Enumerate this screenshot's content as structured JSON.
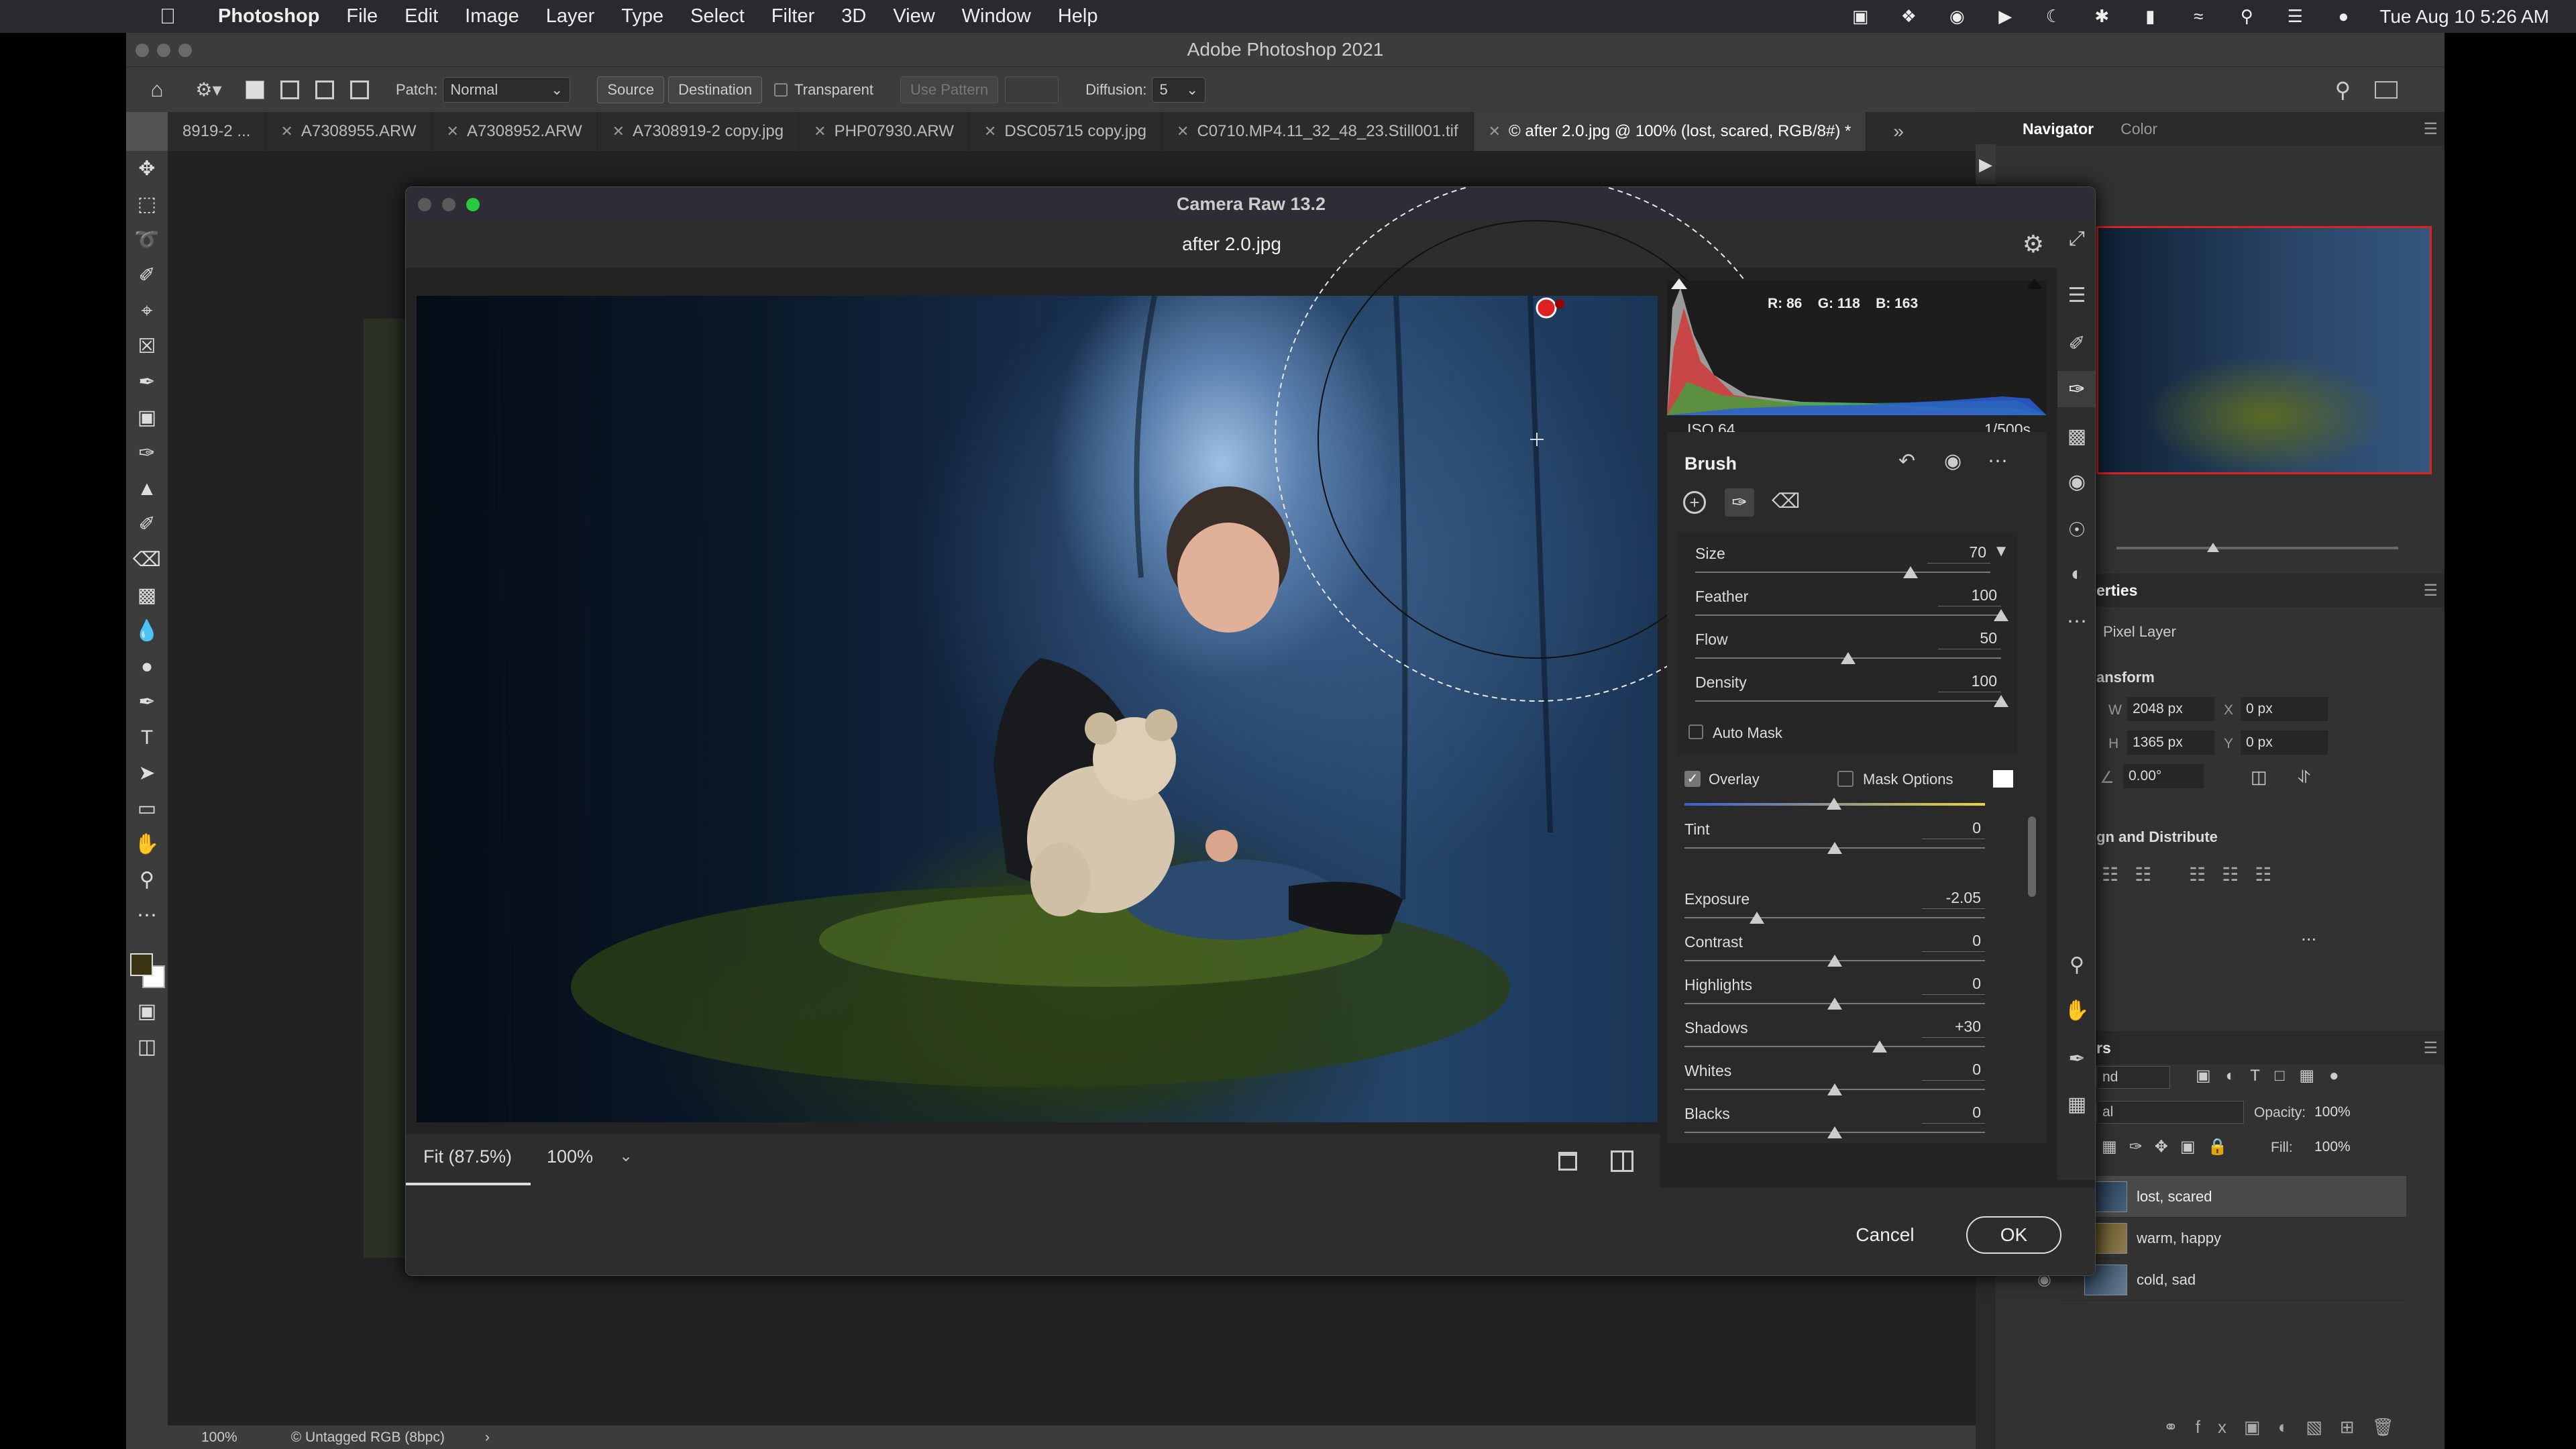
{
  "menubar": {
    "app_name": "Photoshop",
    "items": [
      "File",
      "Edit",
      "Image",
      "Layer",
      "Type",
      "Select",
      "Filter",
      "3D",
      "View",
      "Window",
      "Help"
    ],
    "datetime": "Tue Aug 10  5:26 AM"
  },
  "window": {
    "title": "Adobe Photoshop 2021"
  },
  "options_bar": {
    "patch_label": "Patch:",
    "patch_value": "Normal",
    "source_label": "Source",
    "destination_label": "Destination",
    "transparent_label": "Transparent",
    "use_pattern_label": "Use Pattern",
    "diffusion_label": "Diffusion:",
    "diffusion_value": "5"
  },
  "tabs": [
    {
      "label": "8919-2 ..."
    },
    {
      "label": "A7308955.ARW"
    },
    {
      "label": "A7308952.ARW"
    },
    {
      "label": "A7308919-2 copy.jpg"
    },
    {
      "label": "PHP07930.ARW"
    },
    {
      "label": "DSC05715 copy.jpg"
    },
    {
      "label": "C0710.MP4.11_32_48_23.Still001.tif"
    },
    {
      "label": "© after 2.0.jpg @ 100% (lost, scared, RGB/8#) *"
    }
  ],
  "status_bar": {
    "zoom": "100%",
    "profile": "Untagged RGB (8bpc)"
  },
  "right_panel": {
    "navigator_tab": "Navigator",
    "color_tab": "Color",
    "properties_tab": "erties",
    "pixel_layer": "Pixel Layer",
    "transform_heading": "ansform",
    "w_label": "W",
    "w_value": "2048 px",
    "h_label": "H",
    "h_value": "1365 px",
    "x_label": "X",
    "x_value": "0 px",
    "y_label": "Y",
    "y_value": "0 px",
    "angle_value": "0.00°",
    "align_heading": "gn and Distribute",
    "more": "...",
    "layers_tab": "rs",
    "kind_value": "nd",
    "blend_value": "al",
    "opacity_label": "Opacity:",
    "opacity_value": "100%",
    "fill_label": "Fill:",
    "fill_value": "100%",
    "layers": [
      {
        "name": "lost, scared"
      },
      {
        "name": "warm, happy"
      },
      {
        "name": "cold, sad"
      }
    ]
  },
  "camera_raw": {
    "title": "Camera Raw 13.2",
    "filename": "after 2.0.jpg",
    "histogram": {
      "r": "R: 86",
      "g": "G: 118",
      "b": "B: 163"
    },
    "iso": "ISO 64",
    "shutter": "1/500s",
    "panel_title": "Brush",
    "brush_settings": [
      {
        "label": "Size",
        "value": "70",
        "pos": 0.73
      },
      {
        "label": "Feather",
        "value": "100",
        "pos": 1.0
      },
      {
        "label": "Flow",
        "value": "50",
        "pos": 0.5
      },
      {
        "label": "Density",
        "value": "100",
        "pos": 1.0
      }
    ],
    "auto_mask": "Auto Mask",
    "overlay": "Overlay",
    "mask_options": "Mask Options",
    "adjustments": [
      {
        "label": "Tint",
        "value": "0",
        "pos": 0.5
      },
      {
        "label": "Exposure",
        "value": "-2.05",
        "pos": 0.24
      },
      {
        "label": "Contrast",
        "value": "0",
        "pos": 0.5
      },
      {
        "label": "Highlights",
        "value": "0",
        "pos": 0.5
      },
      {
        "label": "Shadows",
        "value": "+30",
        "pos": 0.65
      },
      {
        "label": "Whites",
        "value": "0",
        "pos": 0.5
      },
      {
        "label": "Blacks",
        "value": "0",
        "pos": 0.5
      }
    ],
    "fit_label": "Fit (87.5%)",
    "zoom_label": "100%",
    "cancel": "Cancel",
    "ok": "OK"
  },
  "colors": {
    "accent": "#e8e8e8",
    "dialog_bg": "#232323",
    "app_bg": "#535353"
  }
}
